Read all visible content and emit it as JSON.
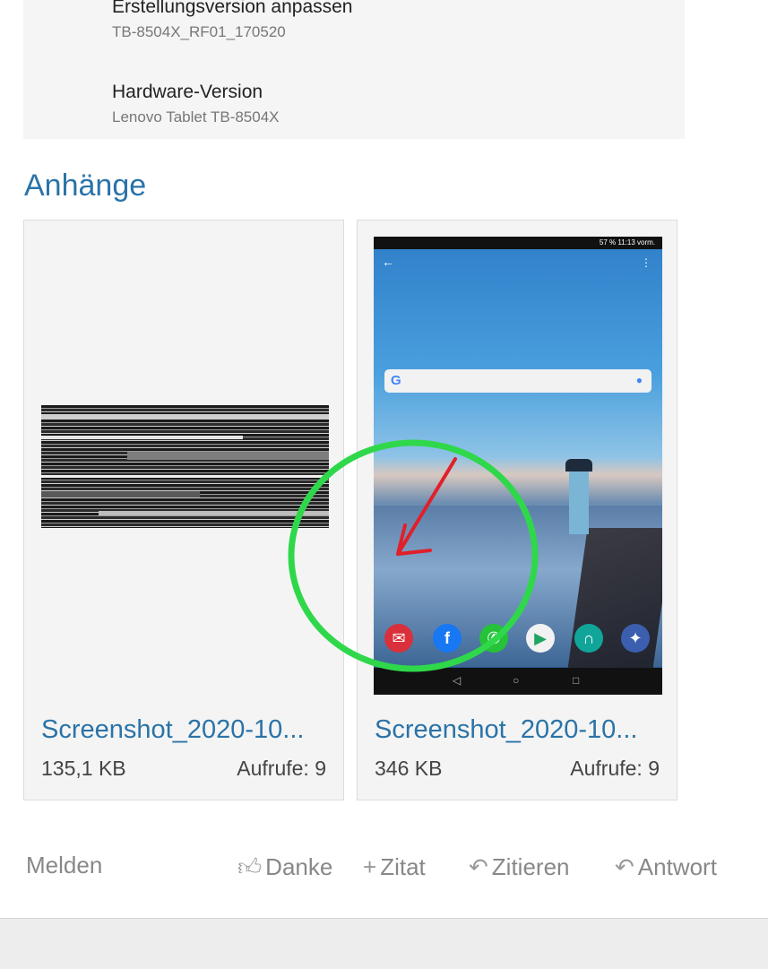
{
  "device_info": [
    {
      "label": "Erstellungsversion anpassen",
      "value": "TB-8504X_RF01_170520"
    },
    {
      "label": "Hardware-Version",
      "value": "Lenovo Tablet TB-8504X"
    }
  ],
  "attachments": {
    "title": "Anhänge",
    "items": [
      {
        "name": "Screenshot_2020-10...",
        "size": "135,1 KB",
        "views": "Aufrufe: 9"
      },
      {
        "name": "Screenshot_2020-10...",
        "size": "346 KB",
        "views": "Aufrufe: 9"
      }
    ]
  },
  "phone_thumb": {
    "time": "11:13 vorm.",
    "battery": "57 %"
  },
  "actions": {
    "report": "Melden",
    "thanks": "Danke",
    "quote_plus": "Zitat",
    "quote": "Zitieren",
    "reply": "Antwort"
  },
  "colors": {
    "link": "#2a73a8",
    "annotation_circle": "#2fd84a",
    "annotation_arrow": "#e0202a"
  }
}
